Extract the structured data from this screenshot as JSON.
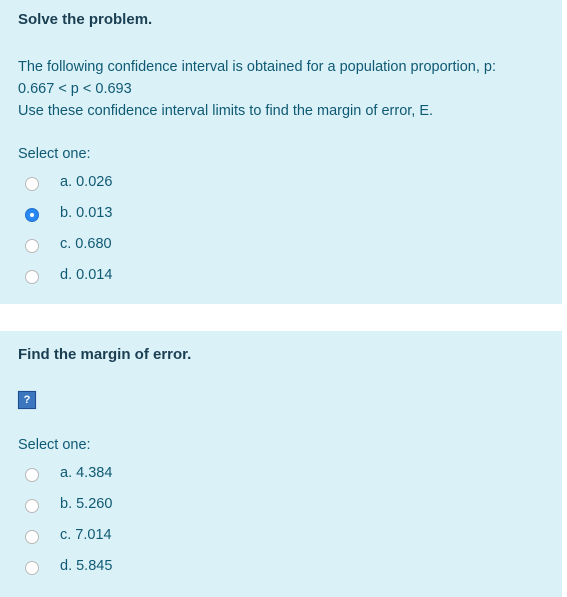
{
  "q1": {
    "title": "Solve the problem.",
    "text_lines": [
      "The following confidence interval is obtained for a population proportion, p:",
      "0.667 < p < 0.693",
      "Use these confidence interval limits to find the margin of error, E."
    ],
    "select_label": "Select one:",
    "options": [
      {
        "label": "a. 0.026",
        "selected": false
      },
      {
        "label": "b. 0.013",
        "selected": true
      },
      {
        "label": "c. 0.680",
        "selected": false
      },
      {
        "label": "d. 0.014",
        "selected": false
      }
    ]
  },
  "q2": {
    "title": "Find the margin of error.",
    "image_icon": "?",
    "select_label": "Select one:",
    "options": [
      {
        "label": "a. 4.384",
        "selected": false
      },
      {
        "label": "b. 5.260",
        "selected": false
      },
      {
        "label": "c. 7.014",
        "selected": false
      },
      {
        "label": "d. 5.845",
        "selected": false
      }
    ]
  },
  "colors": {
    "panel_bg": "#dbf1f8",
    "text": "#0f5a73",
    "title": "#1b3f52",
    "radio_selected": "#2a88f2"
  }
}
